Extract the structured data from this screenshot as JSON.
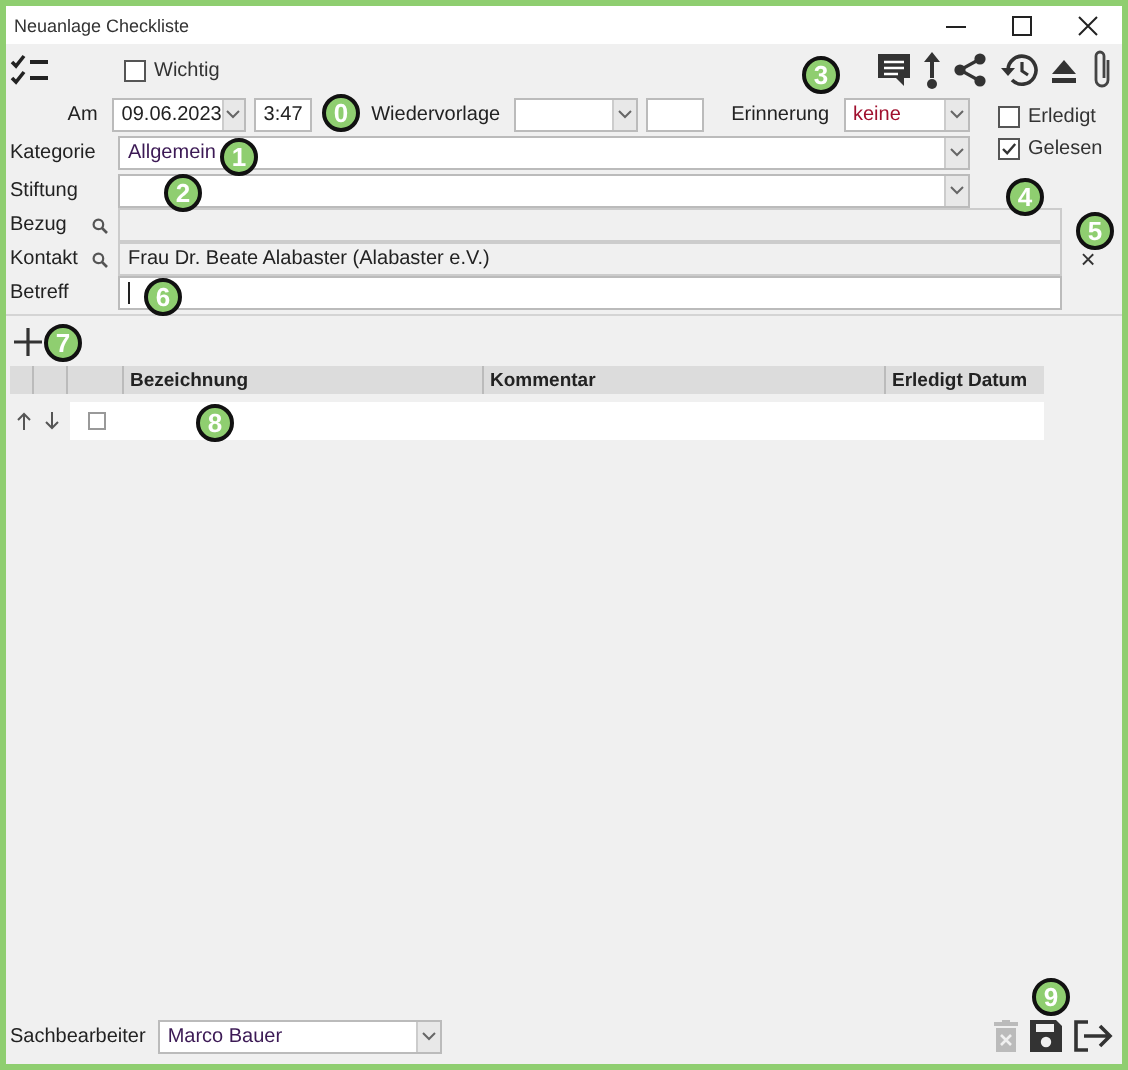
{
  "window": {
    "title": "Neuanlage Checkliste"
  },
  "important": {
    "label": "Wichtig",
    "checked": false
  },
  "date_row": {
    "date_label": "Am",
    "date": "09.06.2023",
    "time": "3:47",
    "followup_label": "Wiedervorlage",
    "reminder_label": "Erinnerung",
    "reminder": "keine"
  },
  "flags": [
    {
      "label": "Erledigt",
      "checked": false
    },
    {
      "label": "Gelesen",
      "checked": true
    }
  ],
  "fields": [
    {
      "kind": "combo",
      "label": "Kategorie",
      "value": "Allgemein"
    },
    {
      "kind": "combo",
      "label": "Stiftung"
    },
    {
      "kind": "lookup",
      "label": "Bezug"
    },
    {
      "kind": "lookup",
      "label": "Kontakt",
      "value": "Frau Dr. Beate Alabaster (Alabaster e.V.)",
      "clear": "×"
    },
    {
      "kind": "text",
      "label": "Betreff",
      "focused": true
    }
  ],
  "table": {
    "columns": [
      "Bezeichnung",
      "Kommentar",
      "Erledigt Datum"
    ],
    "rows": [
      {
        "done": false
      }
    ]
  },
  "footer": {
    "clerk_label": "Sachbearbeiter",
    "clerk": "Marco Bauer",
    "delete_disabled": true
  },
  "callouts": [
    "0",
    "1",
    "2",
    "3",
    "4",
    "5",
    "6",
    "7",
    "8",
    "9"
  ]
}
